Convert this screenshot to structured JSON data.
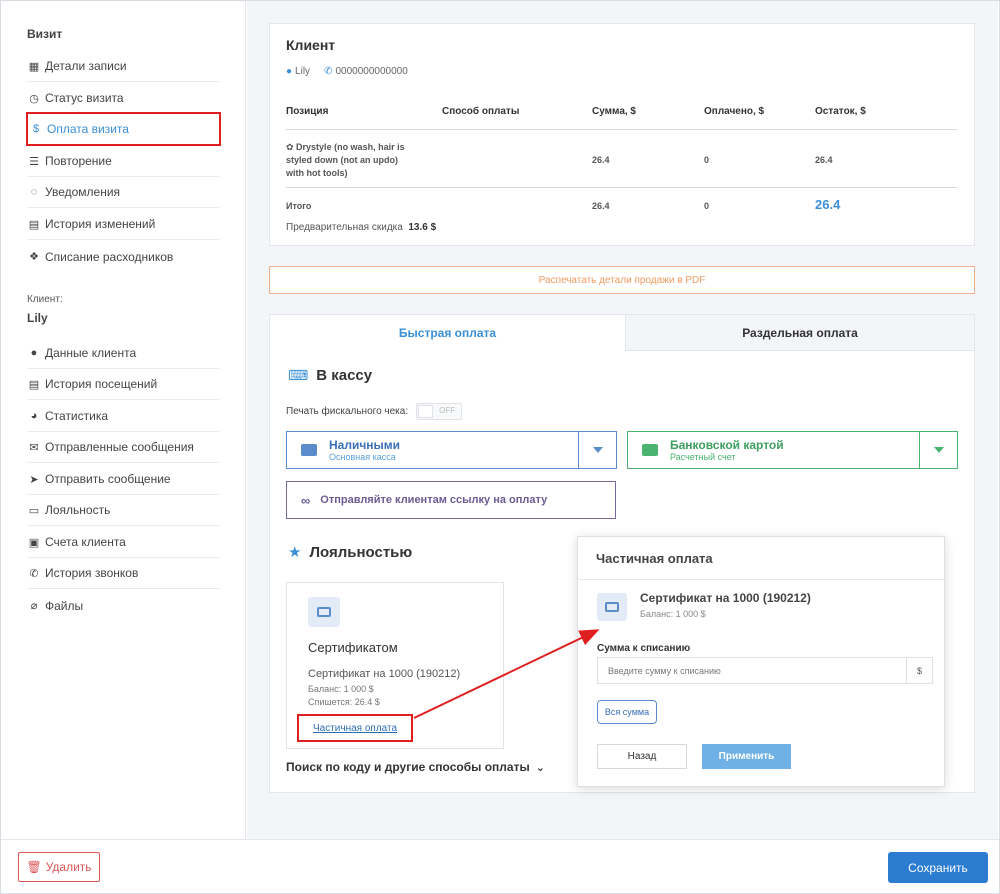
{
  "sidebar": {
    "visit_title": "Визит",
    "visit_items": [
      {
        "label": "Детали записи",
        "icon": "calendar-icon"
      },
      {
        "label": "Статус визита",
        "icon": "clock-icon"
      },
      {
        "label": "Оплата визита",
        "icon": "dollar-icon"
      },
      {
        "label": "Повторение",
        "icon": "list-icon"
      },
      {
        "label": "Уведомления",
        "icon": "chat-icon"
      },
      {
        "label": "История изменений",
        "icon": "document-icon"
      },
      {
        "label": "Списание расходников",
        "icon": "cubes-icon"
      }
    ],
    "client_label": "Клиент:",
    "client_name": "Lily",
    "client_items": [
      {
        "label": "Данные клиента",
        "icon": "user-icon"
      },
      {
        "label": "История посещений",
        "icon": "list-alt-icon"
      },
      {
        "label": "Статистика",
        "icon": "pie-chart-icon"
      },
      {
        "label": "Отправленные сообщения",
        "icon": "envelope-icon"
      },
      {
        "label": "Отправить сообщение",
        "icon": "paper-plane-icon"
      },
      {
        "label": "Лояльность",
        "icon": "card-icon"
      },
      {
        "label": "Счета клиента",
        "icon": "briefcase-icon"
      },
      {
        "label": "История звонков",
        "icon": "phone-icon"
      },
      {
        "label": "Файлы",
        "icon": "paperclip-icon"
      }
    ]
  },
  "client_card": {
    "title": "Клиент",
    "name": "Lily",
    "phone": "0000000000000",
    "columns": [
      "Позиция",
      "Способ оплаты",
      "Сумма, $",
      "Оплачено, $",
      "Остаток, $"
    ],
    "item": {
      "name_line1": "Drystyle (no wash, hair is",
      "name_line2": "styled down (not an updo)",
      "name_line3": "with hot tools)",
      "sum": "26.4",
      "paid": "0",
      "rest": "26.4"
    },
    "total": {
      "label": "Итого",
      "sum": "26.4",
      "paid": "0",
      "rest": "26.4"
    },
    "discount_label": "Предварительная скидка",
    "discount_value": "13.6 $"
  },
  "pdf_button": "Распечатать детали продажи в PDF",
  "tabs": {
    "quick": "Быстрая оплата",
    "split": "Раздельная оплата"
  },
  "cashbox": {
    "title": "В кассу",
    "fiscal_label": "Печать фискального чека:",
    "fiscal_toggle": "OFF",
    "cash": {
      "title": "Наличными",
      "subtitle": "Основная касса"
    },
    "card": {
      "title": "Банковской картой",
      "subtitle": "Расчетный счет"
    },
    "link_button": "Отправляйте клиентам ссылку на оплату"
  },
  "loyalty": {
    "title": "Лояльностью",
    "cert_type": "Сертификатом",
    "cert_name": "Сертификат на 1000 (190212)",
    "balance": "Баланс: 1 000 $",
    "writeoff": "Спишется: 26.4 $",
    "partial_link": "Частичная оплата",
    "more": "Поиск по коду и другие способы оплаты"
  },
  "popup": {
    "title": "Частичная оплата",
    "cert_name": "Сертификат на 1000 (190212)",
    "balance": "Баланс: 1 000 $",
    "amount_label": "Сумма к списанию",
    "amount_placeholder": "Введите сумму к списанию",
    "unit": "$",
    "all_button": "Вся сумма",
    "back_button": "Назад",
    "apply_button": "Применить"
  },
  "footer": {
    "delete": "Удалить",
    "save": "Сохранить"
  },
  "colors": {
    "accent": "#3a8fd6",
    "cash": "#5a8ccc",
    "card": "#49b36f",
    "annotation": "#e02020",
    "save": "#2c7cd1"
  }
}
